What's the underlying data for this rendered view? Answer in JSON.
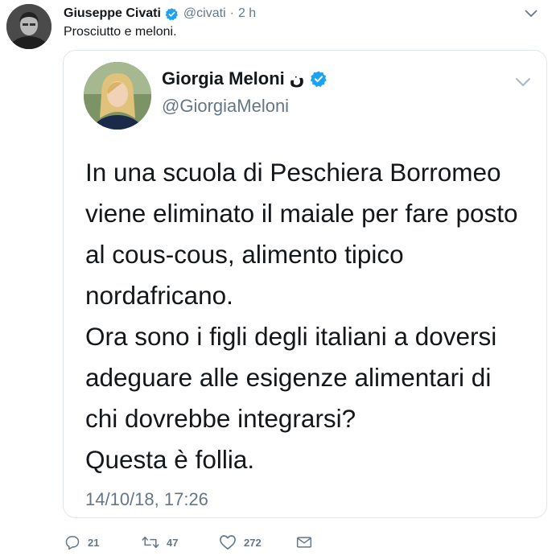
{
  "tweet": {
    "author_name": "Giuseppe Civati",
    "author_handle": "@civati",
    "separator": "·",
    "time_ago": "2 h",
    "text": "Prosciutto e meloni."
  },
  "quoted": {
    "author_name": "Giorgia Meloni",
    "author_name_suffix": "ن",
    "author_handle": "@GiorgiaMeloni",
    "lines": [
      "In una scuola di Peschiera Borromeo",
      "viene eliminato il maiale per fare posto",
      "al cous-cous, alimento tipico",
      "nordafricano.",
      "Ora sono i figli degli italiani a doversi",
      "adeguare alle esigenze alimentari di",
      "chi dovrebbe integrarsi?",
      "Questa è follia."
    ],
    "timestamp": "14/10/18, 17:26"
  },
  "actions": {
    "replies": "21",
    "retweets": "47",
    "likes": "272"
  },
  "icons": {
    "verified": "verified-badge-icon",
    "caret": "chevron-down-icon",
    "reply": "reply-icon",
    "retweet": "retweet-icon",
    "like": "heart-icon",
    "message": "envelope-icon"
  },
  "colors": {
    "verified_blue": "#1da1f2",
    "secondary_text": "#657786",
    "border": "#e1e8ed"
  }
}
